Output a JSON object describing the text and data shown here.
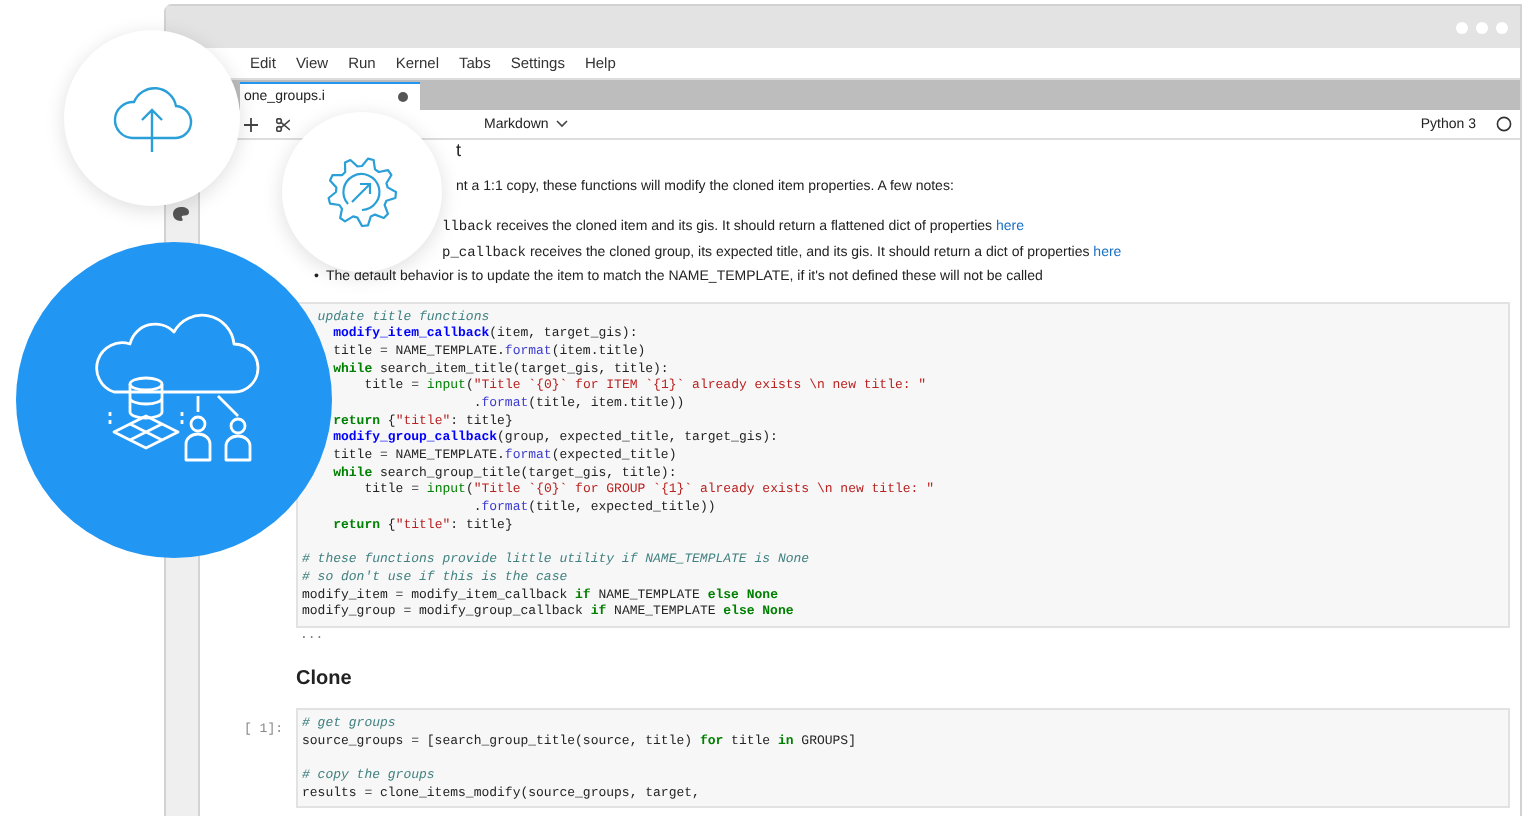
{
  "menu": [
    "Edit",
    "View",
    "Run",
    "Kernel",
    "Tabs",
    "Settings",
    "Help"
  ],
  "tabs": [
    {
      "label": "one_groups.i",
      "selected": true
    }
  ],
  "toolbar": {
    "cell_type": "Markdown",
    "kernel": "Python 3"
  },
  "cells": [
    {
      "kind": "markdown",
      "heading": "t",
      "paragraph": "nt a 1:1 copy, these functions will modify the cloned item properties. A few notes:",
      "notes": [
        {
          "code": "llback",
          "text": " receives the cloned item and its gis. It should return a flattened dict of properties ",
          "link": "here"
        },
        {
          "code": "p_callback",
          "text": " receives the cloned group, its expected title, and its gis. It should return a dict of properties ",
          "link": "here"
        },
        {
          "marker": "•",
          "text": "The default behavior is to update the item to match the NAME_TEMPLATE, if it's not defined these will not be called"
        }
      ]
    },
    {
      "kind": "code",
      "output": "...",
      "lines": [
        {
          "kind": "code",
          "segments": [
            {
              "kind": "comment",
              "text": "  update title functions"
            }
          ]
        },
        {
          "kind": "code",
          "segments": [
            {
              "kind": "def",
              "text": "    modify_item_callback"
            },
            {
              "kind": "plain",
              "text": "(item, target_gis):"
            }
          ]
        },
        {
          "kind": "code",
          "segments": [
            {
              "kind": "plain",
              "text": "    title = NAME_TEMPLATE."
            },
            {
              "kind": "method",
              "text": "format"
            },
            {
              "kind": "plain",
              "text": "(item.title)"
            }
          ]
        },
        {
          "kind": "code",
          "segments": [
            {
              "kind": "keyword",
              "text": "    while"
            },
            {
              "kind": "plain",
              "text": " search_item_title(target_gis, title):"
            }
          ]
        },
        {
          "kind": "code",
          "segments": [
            {
              "kind": "plain",
              "text": "        title = "
            },
            {
              "kind": "builtin",
              "text": "input"
            },
            {
              "kind": "plain",
              "text": "("
            },
            {
              "kind": "string",
              "text": "\"Title `{0}` for ITEM `{1}` already exists \\n new title: \""
            }
          ]
        },
        {
          "kind": "code",
          "segments": [
            {
              "kind": "plain",
              "text": "                      ."
            },
            {
              "kind": "method",
              "text": "format"
            },
            {
              "kind": "plain",
              "text": "(title, item.title))"
            }
          ]
        },
        {
          "kind": "code",
          "segments": [
            {
              "kind": "keyword",
              "text": "    return"
            },
            {
              "kind": "plain",
              "text": " {"
            },
            {
              "kind": "string",
              "text": "\"title\""
            },
            {
              "kind": "plain",
              "text": ": title}"
            }
          ]
        },
        {
          "kind": "code",
          "segments": [
            {
              "kind": "def",
              "text": "    modify_group_callback"
            },
            {
              "kind": "plain",
              "text": "(group, expected_title, target_gis):"
            }
          ]
        },
        {
          "kind": "code",
          "segments": [
            {
              "kind": "plain",
              "text": "    title = NAME_TEMPLATE."
            },
            {
              "kind": "method",
              "text": "format"
            },
            {
              "kind": "plain",
              "text": "(expected_title)"
            }
          ]
        },
        {
          "kind": "code",
          "segments": [
            {
              "kind": "keyword",
              "text": "    while"
            },
            {
              "kind": "plain",
              "text": " search_group_title(target_gis, title):"
            }
          ]
        },
        {
          "kind": "code",
          "segments": [
            {
              "kind": "plain",
              "text": "        title = "
            },
            {
              "kind": "builtin",
              "text": "input"
            },
            {
              "kind": "plain",
              "text": "("
            },
            {
              "kind": "string",
              "text": "\"Title `{0}` for GROUP `{1}` already exists \\n new title: \""
            }
          ]
        },
        {
          "kind": "code",
          "segments": [
            {
              "kind": "plain",
              "text": "                      ."
            },
            {
              "kind": "method",
              "text": "format"
            },
            {
              "kind": "plain",
              "text": "(title, expected_title))"
            }
          ]
        },
        {
          "kind": "code",
          "segments": [
            {
              "kind": "keyword",
              "text": "    return"
            },
            {
              "kind": "plain",
              "text": " {"
            },
            {
              "kind": "string",
              "text": "\"title\""
            },
            {
              "kind": "plain",
              "text": ": title}"
            }
          ]
        },
        {
          "kind": "blank"
        },
        {
          "kind": "code",
          "segments": [
            {
              "kind": "comment",
              "text": "# these functions provide little utility if NAME_TEMPLATE is None"
            }
          ]
        },
        {
          "kind": "code",
          "segments": [
            {
              "kind": "comment",
              "text": "# so don't use if this is the case"
            }
          ]
        },
        {
          "kind": "code",
          "segments": [
            {
              "kind": "plain",
              "text": "modify_item = modify_item_callback "
            },
            {
              "kind": "keyword",
              "text": "if"
            },
            {
              "kind": "plain",
              "text": " NAME_TEMPLATE "
            },
            {
              "kind": "keyword",
              "text": "else None"
            }
          ]
        },
        {
          "kind": "code",
          "segments": [
            {
              "kind": "plain",
              "text": "modify_group = modify_group_callback "
            },
            {
              "kind": "keyword",
              "text": "if"
            },
            {
              "kind": "plain",
              "text": " NAME_TEMPLATE "
            },
            {
              "kind": "keyword",
              "text": "else None"
            }
          ]
        }
      ]
    },
    {
      "kind": "markdown",
      "heading": "Clone"
    },
    {
      "kind": "code",
      "prompt": "[ 1]:",
      "lines": [
        {
          "kind": "code",
          "segments": [
            {
              "kind": "comment",
              "text": "# get groups"
            }
          ]
        },
        {
          "kind": "code",
          "segments": [
            {
              "kind": "plain",
              "text": "source_groups = [search_group_title(source, title) "
            },
            {
              "kind": "keyword",
              "text": "for"
            },
            {
              "kind": "plain",
              "text": " title "
            },
            {
              "kind": "keyword",
              "text": "in"
            },
            {
              "kind": "plain",
              "text": " GROUPS]"
            }
          ]
        },
        {
          "kind": "blank"
        },
        {
          "kind": "code",
          "segments": [
            {
              "kind": "comment",
              "text": "# copy the groups"
            }
          ]
        },
        {
          "kind": "code",
          "segments": [
            {
              "kind": "plain",
              "text": "results = clone_items_modify(source_groups, target,"
            }
          ]
        }
      ]
    }
  ]
}
